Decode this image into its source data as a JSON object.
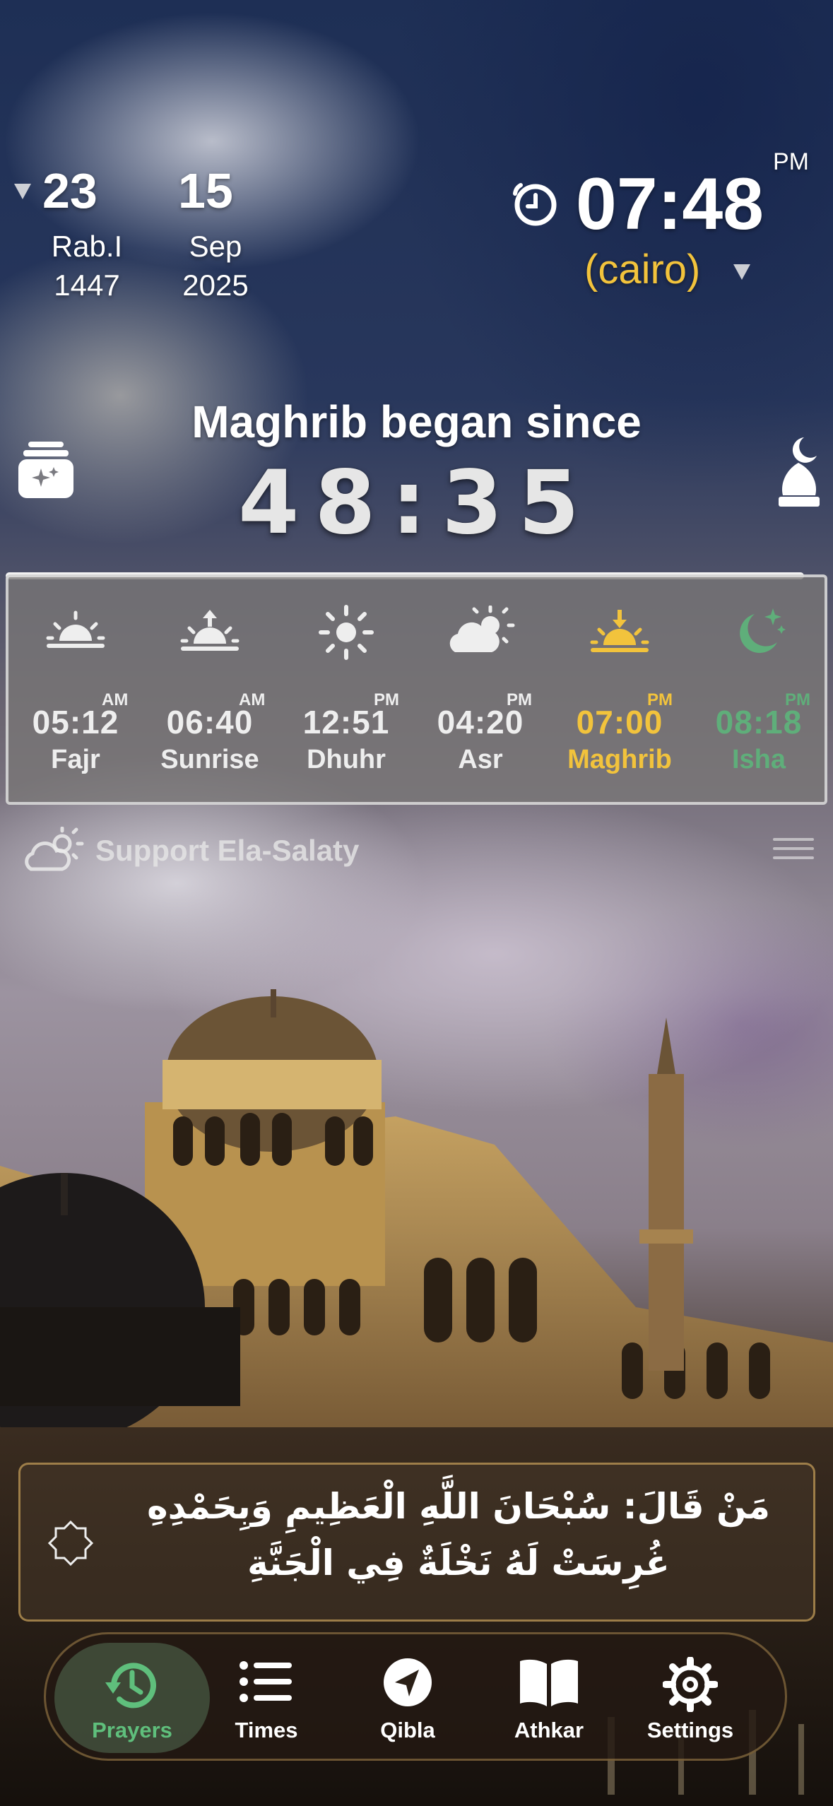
{
  "header": {
    "hijri": {
      "day": "23",
      "month": "Rab.I",
      "year": "1447"
    },
    "gregorian": {
      "day": "15",
      "month": "Sep",
      "year": "2025"
    },
    "clock": {
      "ampm": "PM",
      "time": "07:48",
      "location": "(cairo)"
    }
  },
  "status": {
    "title": "Maghrib began since",
    "countdown": "48:35"
  },
  "prayers": [
    {
      "name": "Fajr",
      "time": "05:12",
      "ampm": "AM",
      "icon": "sunrise-half-icon",
      "color": "#eeeeee"
    },
    {
      "name": "Sunrise",
      "time": "06:40",
      "ampm": "AM",
      "icon": "sun-up-arrow-icon",
      "color": "#eeeeee"
    },
    {
      "name": "Dhuhr",
      "time": "12:51",
      "ampm": "PM",
      "icon": "sun-icon",
      "color": "#eeeeee"
    },
    {
      "name": "Asr",
      "time": "04:20",
      "ampm": "PM",
      "icon": "cloud-sun-icon",
      "color": "#eeeeee"
    },
    {
      "name": "Maghrib",
      "time": "07:00",
      "ampm": "PM",
      "icon": "sunset-icon",
      "color": "#f2c33c"
    },
    {
      "name": "Isha",
      "time": "08:18",
      "ampm": "PM",
      "icon": "moon-stars-icon",
      "color": "#5fae7a"
    }
  ],
  "support": {
    "label": "Support Ela-Salaty"
  },
  "quote": {
    "line1": "مَنْ قَالَ: سُبْحَانَ اللَّهِ الْعَظِيمِ وَبِحَمْدِهِ",
    "line2": "غُرِسَتْ لَهُ نَخْلَةٌ فِي الْجَنَّةِ"
  },
  "tabs": [
    {
      "label": "Prayers",
      "icon": "history-clock-icon",
      "active": true
    },
    {
      "label": "Times",
      "icon": "list-icon",
      "active": false
    },
    {
      "label": "Qibla",
      "icon": "navigation-arrow-icon",
      "active": false
    },
    {
      "label": "Athkar",
      "icon": "open-book-icon",
      "active": false
    },
    {
      "label": "Settings",
      "icon": "gear-icon",
      "active": false
    }
  ],
  "colors": {
    "accent_yellow": "#f2c33c",
    "accent_green": "#5fae7a",
    "active_tab_green": "#5fbf7c"
  }
}
